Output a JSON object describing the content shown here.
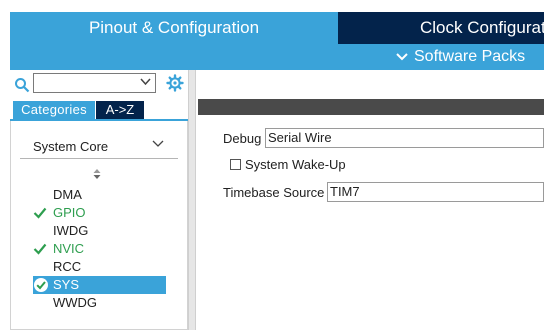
{
  "header": {
    "tab_pinout": "Pinout & Configuration",
    "tab_clock": "Clock Configuration",
    "software_packs": "Software Packs"
  },
  "sidebar": {
    "search": {
      "value": ""
    },
    "tabs": {
      "categories": "Categories",
      "atoz": "A->Z"
    },
    "category": "System Core",
    "items": [
      {
        "label": "DMA",
        "state": "none"
      },
      {
        "label": "GPIO",
        "state": "check"
      },
      {
        "label": "IWDG",
        "state": "none"
      },
      {
        "label": "NVIC",
        "state": "check"
      },
      {
        "label": "RCC",
        "state": "none"
      },
      {
        "label": "SYS",
        "state": "selected"
      },
      {
        "label": "WWDG",
        "state": "none"
      }
    ]
  },
  "config": {
    "debug_label": "Debug",
    "debug_value": "Serial Wire",
    "wakeup_label": "System Wake-Up",
    "wakeup_checked": false,
    "timebase_label": "Timebase Source",
    "timebase_value": "TIM7"
  },
  "colors": {
    "accent": "#3aa3d9",
    "dark": "#03234b",
    "ok_green": "#2e9e4f"
  }
}
